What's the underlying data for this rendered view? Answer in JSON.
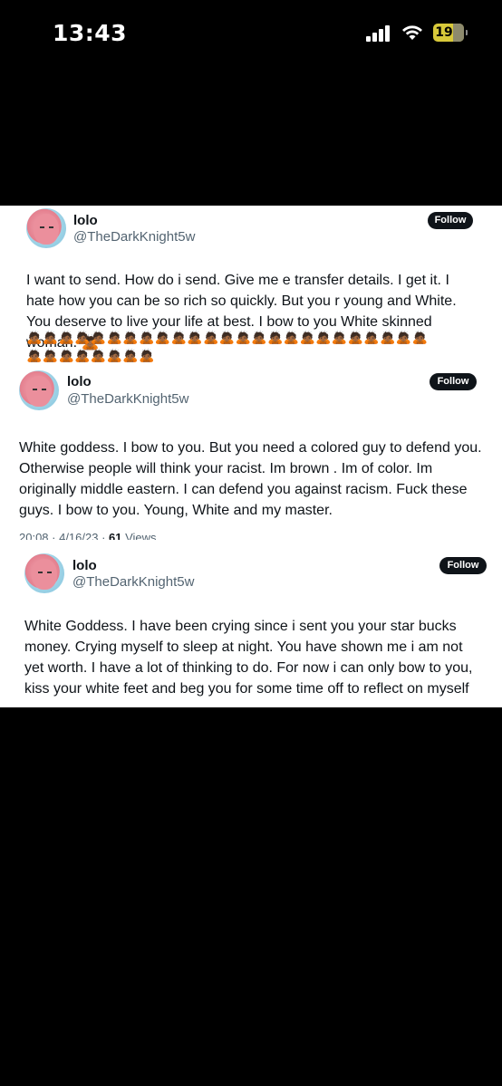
{
  "status_bar": {
    "time": "13:43",
    "battery": "19"
  },
  "tweets": [
    {
      "name": "lolo",
      "handle": "@TheDarkKnight5w",
      "follow_label": "Follow",
      "text": "I want to send. How do i send. Give me e transfer details. I get it. I hate how you can be so rich so quickly. But you r young and White. You deserve to live your life at best. I bow to you White skinned woman. 🙇🏾",
      "emoji_row1": "🙇🏾🙇🏾🙇🏾🙇🏾🙇🏾🙇🏾🙇🏾🙇🏾🙇🏾🙇🏾🙇🏾🙇🏾🙇🏾🙇🏾🙇🏾🙇🏾🙇🏾🙇🏾🙇🏾🙇🏾🙇🏾🙇🏾🙇🏾🙇🏾🙇🏾",
      "emoji_row2": "🙇🏾🙇🏾🙇🏾🙇🏾🙇🏾🙇🏾🙇🏾🙇🏾"
    },
    {
      "name": "lolo",
      "handle": "@TheDarkKnight5w",
      "follow_label": "Follow",
      "text": "White goddess. I bow to you. But you need a colored guy to defend you. Otherwise people will think your racist. Im brown . Im of color. Im originally middle eastern. I can defend you against racism. Fuck these guys. I bow to you. Young, White and my master.",
      "meta_date": "20:08 · 4/16/23 · ",
      "meta_views_count": "61",
      "meta_views_label": " Views"
    },
    {
      "name": "lolo",
      "handle": "@TheDarkKnight5w",
      "follow_label": "Follow",
      "text": "White Goddess. I have been crying since i sent you your star bucks money. Crying myself to sleep at night. You have shown me i am not yet worth. I have a lot of thinking to do. For now i can only bow to you, kiss your white feet and beg you for some time off to reflect on myself"
    }
  ]
}
